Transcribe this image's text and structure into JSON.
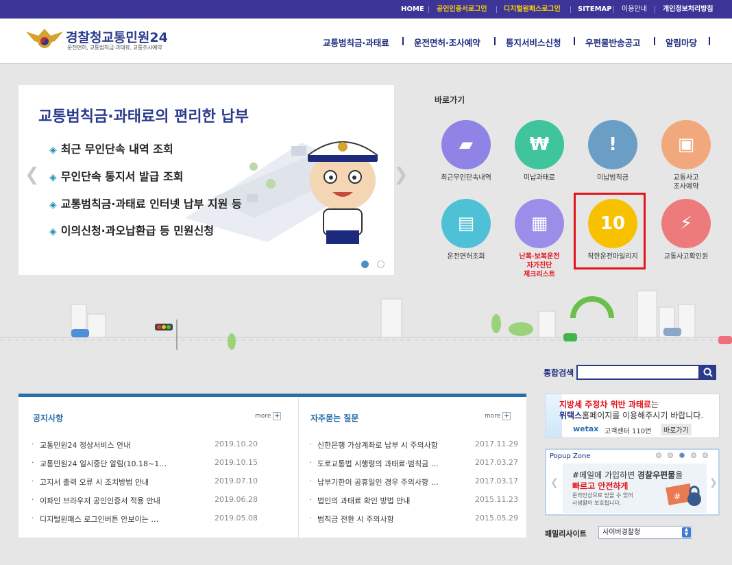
{
  "topnav": {
    "home": "HOME",
    "cert_login": "공인인증서로그인",
    "digital_login": "디지털원패스로그인",
    "sitemap": "SITEMAP",
    "guide": "이용안내",
    "privacy": "개인정보처리방침"
  },
  "logo": {
    "title": "경찰청교통민원24",
    "subtitle": "운전면허, 교통범칙금·과태료, 교통조사예약"
  },
  "gnb": [
    "교통범칙금·과태료",
    "운전면허·조사예약",
    "통지서비스신청",
    "우편물반송공고",
    "알림마당"
  ],
  "banner": {
    "title": "교통범칙금·과태료의 편리한 납부",
    "items": [
      "최근 무인단속 내역 조회",
      "무인단속 통지서 발급 조회",
      "교통범칙금·과태료 인터넷 납부 지원 등",
      "이의신청·과오납환급 등 민원신청"
    ]
  },
  "quick": {
    "title": "바로가기",
    "items": [
      {
        "label": "최근무인단속내역",
        "color": "#8f83e6",
        "icon": "camera-icon"
      },
      {
        "label": "미납과태료",
        "color": "#3fc49c",
        "icon": "money-icon"
      },
      {
        "label": "미납범칙금",
        "color": "#6a9ec4",
        "icon": "warning-icon"
      },
      {
        "label": "교통사고\n조사예약",
        "color": "#f0a87c",
        "icon": "monitor-icon"
      },
      {
        "label": "운전면허조회",
        "color": "#4ec1d6",
        "icon": "license-icon"
      },
      {
        "label": "난폭·보복운전\n자가진단\n체크리스트",
        "color": "#9a8ee8",
        "icon": "calendar-icon"
      },
      {
        "label": "착한운전마일리지",
        "color": "#f7c100",
        "icon": "mileage-icon"
      },
      {
        "label": "교통사고확인원",
        "color": "#ee7b7b",
        "icon": "accident-icon"
      }
    ]
  },
  "search": {
    "label": "통합검색",
    "placeholder": ""
  },
  "notice": {
    "title": "공지사항",
    "more": "more",
    "items": [
      {
        "title": "교통민원24 정상서비스 안내",
        "date": "2019.10.20"
      },
      {
        "title": "교통민원24 일시중단 알림(10.18~1…",
        "date": "2019.10.15"
      },
      {
        "title": "고지서 출력 오류 시 조치방법 안내",
        "date": "2019.07.10"
      },
      {
        "title": "이파인 브라우저 공인인증서 적용 안내",
        "date": "2019.06.28"
      },
      {
        "title": "디지털원패스 로그인버튼 안보이는 …",
        "date": "2019.05.08"
      }
    ]
  },
  "faq": {
    "title": "자주묻는 질문",
    "more": "more",
    "items": [
      {
        "title": "신한은행 가상계좌로 납부 시 주의사항",
        "date": "2017.11.29"
      },
      {
        "title": "도로교통법 시행령의 과태료·범칙금 …",
        "date": "2017.03.27"
      },
      {
        "title": "납부기한이 공휴일인 경우 주의사항 …",
        "date": "2017.03.17"
      },
      {
        "title": "법인의 과태료 확인 방법 안내",
        "date": "2015.11.23"
      },
      {
        "title": "범칙금 전환 시 주의사항",
        "date": "2015.05.29"
      }
    ]
  },
  "ad": {
    "line1a": "지방세 주정차 위반 과태료",
    "line1b": "는",
    "line2a": "위택스",
    "line2b": "홈페이지를 이용해주시기 바랍니다.",
    "brand": "wetax",
    "center": "고객센터 110번",
    "go": "바로가기"
  },
  "popup": {
    "title": "Popup Zone",
    "line1a": "#메일",
    "line1b": "에 가입하면 ",
    "line1c": "경찰우편물",
    "line1d": "을",
    "line2": "빠르고 안전하게",
    "line3": "온라인상으로 받을 수 있어",
    "line4": "사생활이 보호됩니다."
  },
  "family": {
    "label": "패밀리사이트",
    "selected": "사이버경찰청"
  }
}
